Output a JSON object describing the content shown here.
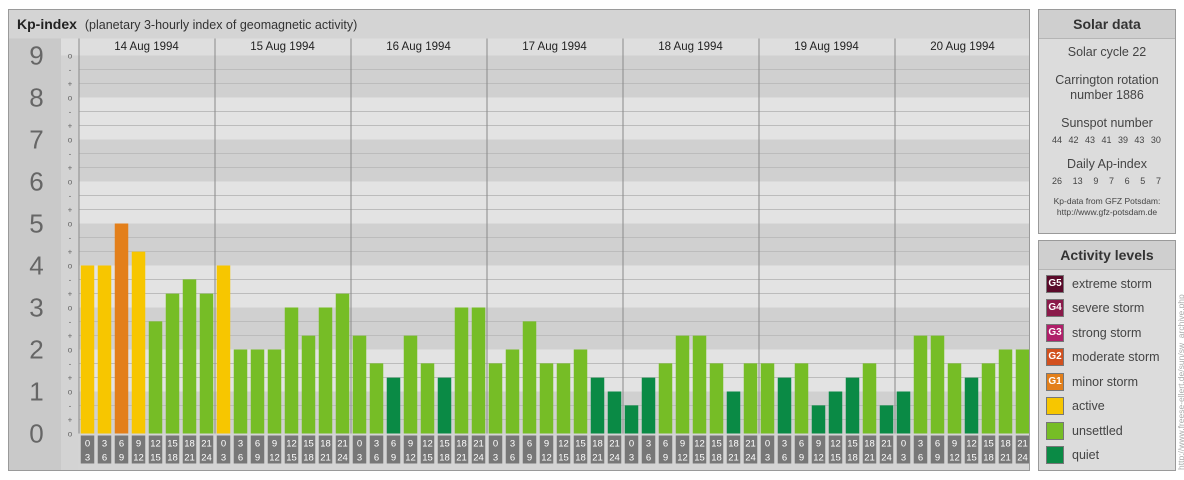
{
  "chart": {
    "title": "Kp-index",
    "subtitle": "(planetary 3-hourly index of geomagnetic activity)"
  },
  "chart_data": {
    "type": "bar",
    "ylim": [
      0,
      9
    ],
    "y_ticks": [
      "0",
      "1",
      "2",
      "3",
      "4",
      "5",
      "6",
      "7",
      "8",
      "9"
    ],
    "minor_tick_labels": [
      "+",
      "o",
      "-"
    ],
    "days": [
      "14 Aug 1994",
      "15 Aug 1994",
      "16 Aug 1994",
      "17 Aug 1994",
      "18 Aug 1994",
      "19 Aug 1994",
      "20 Aug 1994"
    ],
    "hour_start": [
      "0",
      "3",
      "6",
      "9",
      "12",
      "15",
      "18",
      "21"
    ],
    "hour_end": [
      "3",
      "6",
      "9",
      "12",
      "15",
      "18",
      "21",
      "24"
    ],
    "values": [
      4,
      4,
      5,
      4.33,
      2.67,
      3.33,
      3.67,
      3.33,
      4,
      2,
      2,
      2,
      3,
      2.33,
      3,
      3.33,
      2.33,
      1.67,
      1.33,
      2.33,
      1.67,
      1.33,
      3,
      3,
      1.67,
      2,
      2.67,
      1.67,
      1.67,
      2,
      1.33,
      1,
      0.67,
      1.33,
      1.67,
      2.33,
      2.33,
      1.67,
      1,
      1.67,
      1.67,
      1.33,
      1.67,
      0.67,
      1,
      1.33,
      1.67,
      0.67,
      1,
      2.33,
      2.33,
      1.67,
      1.33,
      1.67,
      2,
      2
    ],
    "grid": true
  },
  "solar": {
    "title": "Solar data",
    "cycle": "Solar cycle 22",
    "carrington_line1": "Carrington rotation",
    "carrington_line2": "number 1886",
    "sunspot_label": "Sunspot number",
    "sunspot_values": [
      "44",
      "42",
      "43",
      "41",
      "39",
      "43",
      "30"
    ],
    "ap_label": "Daily Ap-index",
    "ap_values": [
      "26",
      "13",
      "9",
      "7",
      "6",
      "5",
      "7"
    ],
    "credit_line1": "Kp-data from GFZ Potsdam:",
    "credit_line2": "http://www.gfz-potsdam.de"
  },
  "activity": {
    "title": "Activity levels",
    "levels": [
      {
        "code": "G5",
        "label": "extreme storm",
        "color": "#5a0a2a"
      },
      {
        "code": "G4",
        "label": "severe storm",
        "color": "#8a1a4a"
      },
      {
        "code": "G3",
        "label": "strong storm",
        "color": "#b01f6a"
      },
      {
        "code": "G2",
        "label": "moderate storm",
        "color": "#d2501e"
      },
      {
        "code": "G1",
        "label": "minor storm",
        "color": "#e37f1a"
      },
      {
        "code": "",
        "label": "active",
        "color": "#f7c600"
      },
      {
        "code": "",
        "label": "unsettled",
        "color": "#76bd26"
      },
      {
        "code": "",
        "label": "quiet",
        "color": "#0a8a45"
      }
    ]
  },
  "watermark": "http://www.freese-ellert.de/sun/sw_archive.php"
}
